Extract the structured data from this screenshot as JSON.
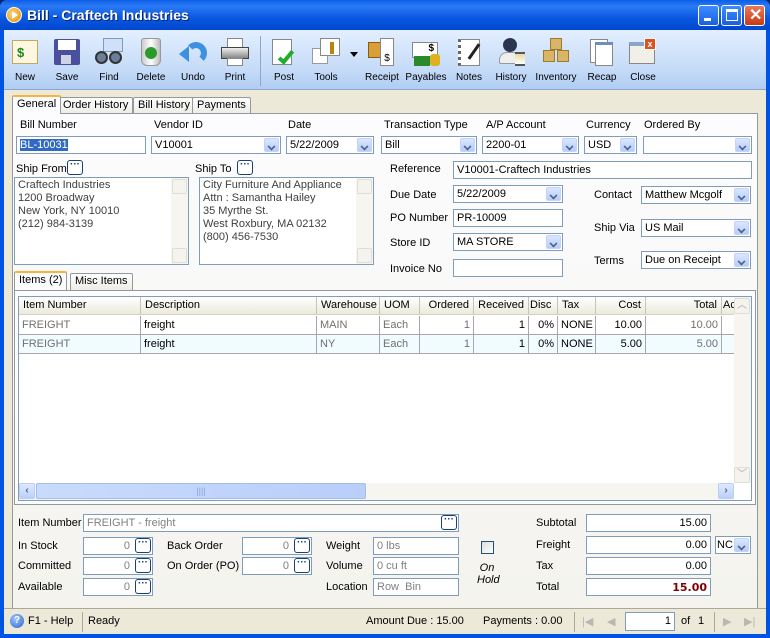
{
  "window": {
    "title": "Bill - Craftech Industries"
  },
  "toolbar": {
    "buttons": [
      {
        "label": "New",
        "icon": "new-bill-icon"
      },
      {
        "label": "Save",
        "icon": "floppy-disk-icon"
      },
      {
        "label": "Find",
        "icon": "binoculars-icon"
      },
      {
        "label": "Delete",
        "icon": "recycle-bin-icon"
      },
      {
        "label": "Undo",
        "icon": "undo-arrow-icon"
      },
      {
        "label": "Print",
        "icon": "printer-icon"
      },
      {
        "label": "Post",
        "icon": "post-checkmark-icon"
      },
      {
        "label": "Tools",
        "icon": "tools-icon"
      },
      {
        "label": "Receipt",
        "icon": "receipt-icon"
      },
      {
        "label": "Payables",
        "icon": "payables-icon"
      },
      {
        "label": "Notes",
        "icon": "notes-icon"
      },
      {
        "label": "History",
        "icon": "history-icon"
      },
      {
        "label": "Inventory",
        "icon": "inventory-boxes-icon"
      },
      {
        "label": "Recap",
        "icon": "recap-icon"
      },
      {
        "label": "Close",
        "icon": "close-window-icon"
      }
    ]
  },
  "tabs": [
    "General",
    "Order History",
    "Bill History",
    "Payments"
  ],
  "header": {
    "bill_number": {
      "label": "Bill Number",
      "value": "BL-10031"
    },
    "vendor_id": {
      "label": "Vendor ID",
      "value": "V10001"
    },
    "date": {
      "label": "Date",
      "value": "5/22/2009"
    },
    "transaction_type": {
      "label": "Transaction Type",
      "value": "Bill"
    },
    "ap_account": {
      "label": "A/P Account",
      "value": "2200-01"
    },
    "currency": {
      "label": "Currency",
      "value": "USD"
    },
    "ordered_by": {
      "label": "Ordered By",
      "value": ""
    }
  },
  "ship_from": {
    "label": "Ship From",
    "lines": [
      "Craftech Industries",
      "1200 Broadway",
      "New York, NY 10010",
      "(212) 984-3139"
    ]
  },
  "ship_to": {
    "label": "Ship To",
    "lines": [
      "City Furniture And Appliance",
      "Attn : Samantha Hailey",
      "35 Myrthe St.",
      "West Roxbury, MA 02132",
      "(800) 456-7530"
    ]
  },
  "details": {
    "reference": {
      "label": "Reference",
      "value": "V10001-Craftech Industries"
    },
    "due_date": {
      "label": "Due Date",
      "value": "5/22/2009"
    },
    "po_number": {
      "label": "PO Number",
      "value": "PR-10009"
    },
    "store_id": {
      "label": "Store ID",
      "value": "MA STORE"
    },
    "invoice_no": {
      "label": "Invoice No",
      "value": ""
    },
    "contact": {
      "label": "Contact",
      "value": "Matthew Mcgolf"
    },
    "ship_via": {
      "label": "Ship Via",
      "value": "US Mail"
    },
    "terms": {
      "label": "Terms",
      "value": "Due on Receipt"
    }
  },
  "item_tabs": [
    "Items (2)",
    "Misc Items"
  ],
  "grid": {
    "columns": [
      "Item Number",
      "Description",
      "Warehouse",
      "UOM",
      "Ordered",
      "Received",
      "Disc",
      "Tax",
      "Cost",
      "Total",
      "Ac"
    ],
    "rows": [
      [
        "FREIGHT",
        "freight",
        "MAIN",
        "Each",
        "1",
        "1",
        "0%",
        "NONE",
        "10.00",
        "10.00",
        ""
      ],
      [
        "FREIGHT",
        "freight",
        "NY",
        "Each",
        "1",
        "1",
        "0%",
        "NONE",
        "5.00",
        "5.00",
        ""
      ]
    ]
  },
  "item_info": {
    "item_number": {
      "label": "Item Number",
      "value": "FREIGHT - freight"
    },
    "in_stock": {
      "label": "In Stock",
      "value": "0"
    },
    "committed": {
      "label": "Committed",
      "value": "0"
    },
    "available": {
      "label": "Available",
      "value": "0"
    },
    "back_order": {
      "label": "Back Order",
      "value": "0"
    },
    "on_order": {
      "label": "On Order (PO)",
      "value": "0"
    },
    "weight": {
      "label": "Weight",
      "value": "0 lbs"
    },
    "volume": {
      "label": "Volume",
      "value": "0 cu ft"
    },
    "location": {
      "label": "Location",
      "value": "Row  Bin"
    },
    "on_hold": {
      "label": "On Hold",
      "checked": false
    }
  },
  "totals": {
    "subtotal": {
      "label": "Subtotal",
      "value": "15.00"
    },
    "freight": {
      "label": "Freight",
      "value": "0.00",
      "code": "NC"
    },
    "tax": {
      "label": "Tax",
      "value": "0.00"
    },
    "total": {
      "label": "Total",
      "value": "15.00",
      "color": "#800000"
    }
  },
  "status": {
    "help": "F1 - Help",
    "state": "Ready",
    "amount_due": "Amount Due : 15.00",
    "payments": "Payments : 0.00",
    "page": "1",
    "of": "of",
    "page_count": "1"
  }
}
